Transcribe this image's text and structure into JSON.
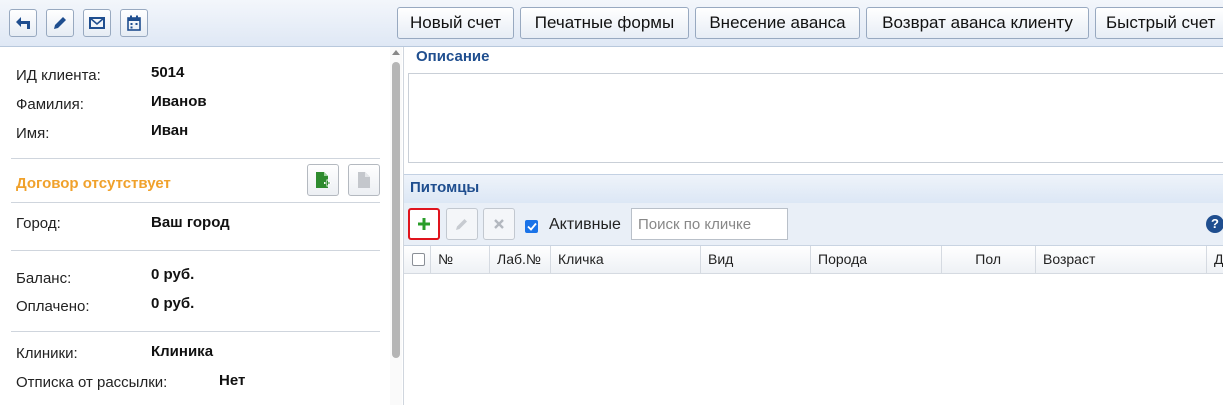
{
  "toolbar": {
    "icon_buttons": [
      {
        "name": "back-icon"
      },
      {
        "name": "pencil-icon"
      },
      {
        "name": "mail-icon"
      },
      {
        "name": "calendar-icon"
      }
    ],
    "actions": [
      {
        "label": "Новый счет"
      },
      {
        "label": "Печатные формы"
      },
      {
        "label": "Внесение аванса"
      },
      {
        "label": "Возврат аванса клиенту"
      },
      {
        "label": "Быстрый счет"
      }
    ]
  },
  "client": {
    "id_label": "ИД клиента:",
    "id_value": "5014",
    "surname_label": "Фамилия:",
    "surname_value": "Иванов",
    "name_label": "Имя:",
    "name_value": "Иван",
    "contract_status": "Договор отсутствует",
    "city_label": "Город:",
    "city_value": "Ваш город",
    "balance_label": "Баланс:",
    "balance_value": "0 руб.",
    "paid_label": "Оплачено:",
    "paid_value": "0 руб.",
    "clinics_label": "Клиники:",
    "clinics_value": "Клиника",
    "unsubscribe_label": "Отписка от рассылки:",
    "unsubscribe_value": "Нет"
  },
  "description": {
    "title": "Описание",
    "value": ""
  },
  "pets": {
    "title": "Питомцы",
    "active_label": "Активные",
    "active_checked": true,
    "search_placeholder": "Поиск по кличке",
    "help": "?",
    "columns": [
      "№",
      "Лаб.№",
      "Кличка",
      "Вид",
      "Порода",
      "Пол",
      "Возраст",
      "Д"
    ]
  },
  "colors": {
    "accent_blue": "#1f4e8f",
    "contract_orange": "#f0a12b",
    "add_green": "#2a9d2a",
    "highlight_red": "#e0141d"
  }
}
